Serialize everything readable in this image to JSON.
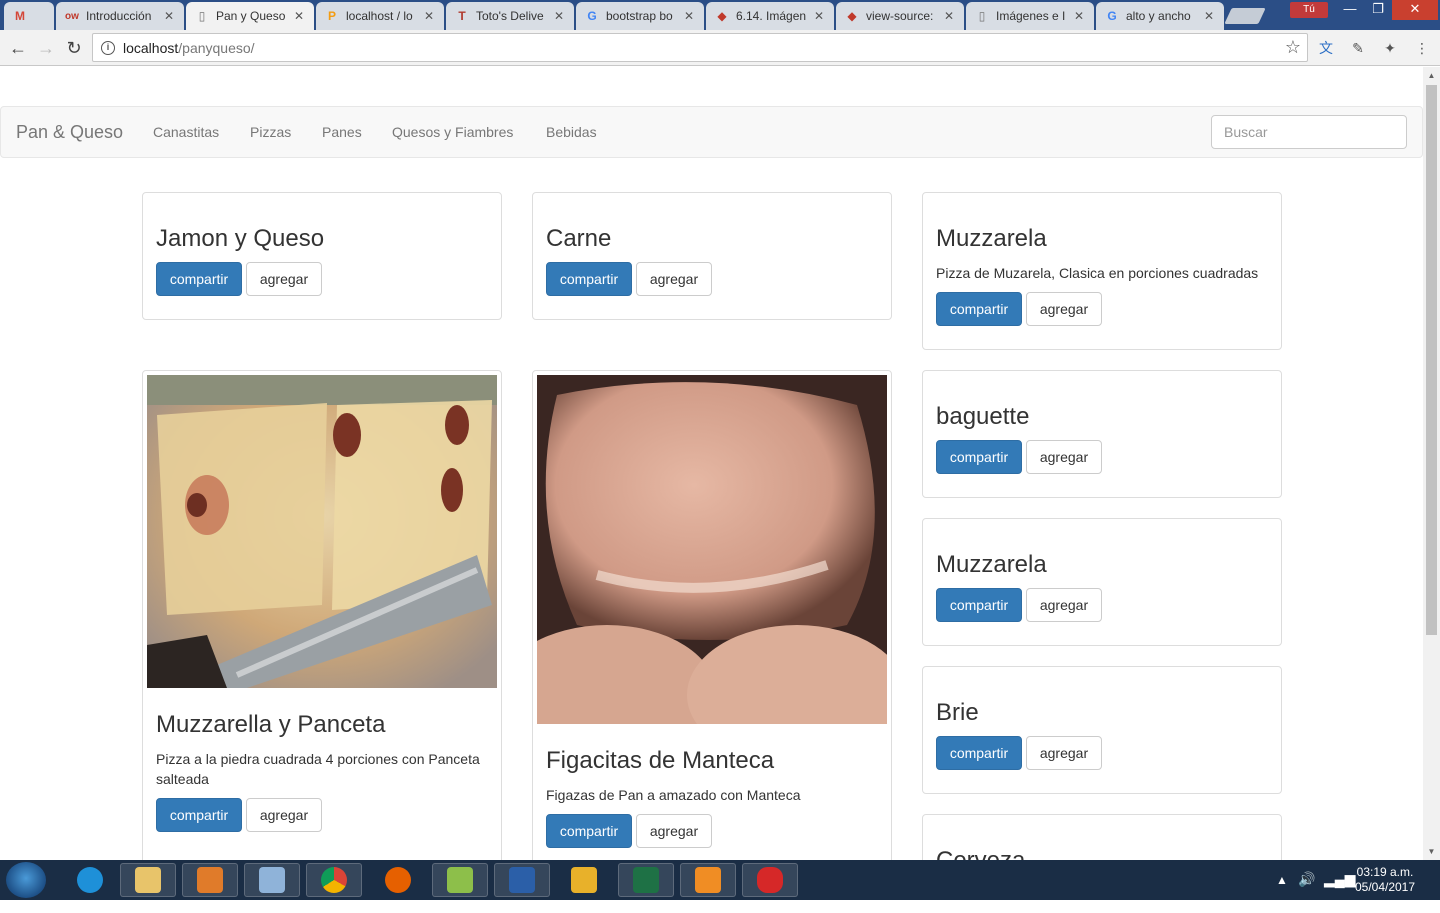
{
  "browser": {
    "tabs": [
      {
        "title": "",
        "icon": "gmail-icon",
        "icon_char": "M",
        "color": "#d44638"
      },
      {
        "title": "Introducción",
        "icon": "openwebinars-icon",
        "icon_char": "ow",
        "color": "#c0392b"
      },
      {
        "title": "Pan y Queso",
        "icon": "page-icon",
        "icon_char": "▯",
        "color": "#777777",
        "active": true
      },
      {
        "title": "localhost / lo",
        "icon": "phpmyadmin-icon",
        "icon_char": "P",
        "color": "#f39c12"
      },
      {
        "title": "Toto's Delive",
        "icon": "totos-icon",
        "icon_char": "T",
        "color": "#b03a2e"
      },
      {
        "title": "bootstrap bo",
        "icon": "google-icon",
        "icon_char": "G",
        "color": "#4285f4"
      },
      {
        "title": "6.14. Imágen",
        "icon": "book-icon",
        "icon_char": "◆",
        "color": "#c0392b"
      },
      {
        "title": "view-source:",
        "icon": "book-icon",
        "icon_char": "◆",
        "color": "#c0392b"
      },
      {
        "title": "Imágenes e I",
        "icon": "page-icon",
        "icon_char": "▯",
        "color": "#777777"
      },
      {
        "title": "alto y ancho",
        "icon": "google-icon",
        "icon_char": "G",
        "color": "#4285f4"
      }
    ],
    "user_label": "Tú",
    "url_host": "localhost",
    "url_path": "/panyqueso/"
  },
  "navbar": {
    "brand": "Pan & Queso",
    "links": [
      "Canastitas",
      "Pizzas",
      "Panes",
      "Quesos y Fiambres",
      "Bebidas"
    ],
    "search_placeholder": "Buscar"
  },
  "buttons": {
    "share": "compartir",
    "add": "agregar"
  },
  "products": [
    {
      "title": "Jamon y Queso",
      "description": ""
    },
    {
      "title": "Carne",
      "description": ""
    },
    {
      "title": "Muzzarela",
      "description": "Pizza de Muzarela, Clasica en porciones cuadradas"
    },
    {
      "title": "Muzzarella y Panceta",
      "description": "Pizza a la piedra cuadrada 4 porciones con Panceta salteada"
    },
    {
      "title": "Figacitas de Manteca",
      "description": "Figazas de Pan a amazado con Manteca"
    },
    {
      "title": "baguette",
      "description": ""
    },
    {
      "title": "Muzzarela",
      "description": ""
    },
    {
      "title": "Brie",
      "description": ""
    },
    {
      "title": "Cerveza",
      "description": ""
    }
  ],
  "taskbar": {
    "apps": [
      "internet-explorer-icon",
      "file-explorer-icon",
      "media-player-icon",
      "tool-icon",
      "chrome-icon",
      "firefox-icon",
      "notepad-icon",
      "save-icon",
      "winamp-icon",
      "excel-icon",
      "sublime-icon",
      "paint-icon"
    ],
    "time": "03:19 a.m.",
    "date": "05/04/2017"
  },
  "colors": {
    "primary": "#337ab7",
    "navbar_bg": "#f8f8f8",
    "taskbar_bg": "#1a2d45"
  }
}
